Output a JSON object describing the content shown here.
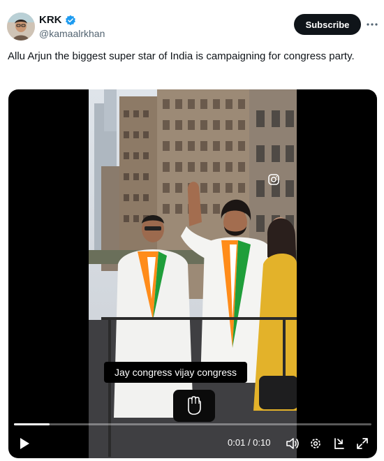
{
  "author": {
    "display_name": "KRK",
    "handle": "@kamaalrkhan",
    "verified_icon": "verified-badge-icon",
    "avatar_icon": "avatar"
  },
  "actions": {
    "subscribe_label": "Subscribe",
    "more_icon": "more-icon"
  },
  "tweet": {
    "text": "Allu Arjun the biggest super star of India is campaigning for congress party."
  },
  "video": {
    "caption": "Jay congress vijay congress",
    "current_time": "0:01",
    "duration": "0:10",
    "time_display": "0:01 / 0:10",
    "progress": 0.1,
    "icons": [
      "play-icon",
      "volume-icon",
      "settings-icon",
      "download-icon",
      "fullscreen-icon",
      "fist-sticker-icon",
      "instagram-icon"
    ]
  },
  "colors": {
    "verified": "#1d9bf0",
    "button_bg": "#0f1419",
    "secondary_text": "#536471"
  }
}
